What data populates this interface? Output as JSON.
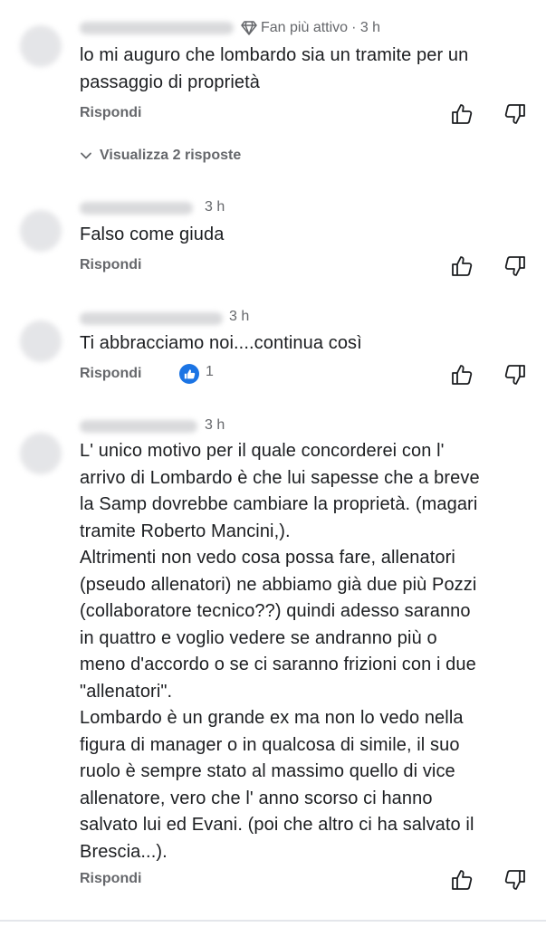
{
  "comments": [
    {
      "badge": "Fan più attivo",
      "time": "· 3 h",
      "lines": [
        "lo mi auguro che lombardo sia un tramite per un",
        "passaggio di proprietà"
      ],
      "reply_label": "Rispondi"
    },
    {
      "time": "3 h",
      "lines": [
        "Falso come giuda"
      ],
      "reply_label": "Rispondi"
    },
    {
      "time": "3 h",
      "lines": [
        "Ti abbracciamo noi....continua così"
      ],
      "reply_label": "Rispondi",
      "reactions": "1"
    },
    {
      "time": "3 h",
      "lines": [
        "L' unico motivo per il quale concorderei con l'",
        "arrivo di Lombardo è che lui sapesse che a breve",
        "la Samp dovrebbe cambiare la proprietà. (magari",
        "tramite Roberto Mancini,).",
        "Altrimenti non vedo cosa possa fare, allenatori",
        "(pseudo allenatori) ne abbiamo già  due più Pozzi",
        "(collaboratore tecnico??) quindi adesso saranno",
        "in quattro e voglio vedere se andranno più o",
        "meno d'accordo o se ci saranno frizioni con i due",
        "\"allenatori\".",
        "Lombardo è un grande ex ma non lo vedo nella",
        "figura di manager o in qualcosa di simile, il suo",
        "ruolo è sempre stato al massimo quello di vice",
        "allenatore, vero che l' anno scorso ci hanno",
        "salvato lui ed Evani.  (poi che altro ci ha salvato il",
        "Brescia...)."
      ],
      "reply_label": "Rispondi"
    }
  ],
  "view_replies": "Visualizza 2 risposte",
  "icons": {
    "like": "thumbs-up-icon",
    "dislike": "thumbs-down-icon",
    "badge": "diamond-icon",
    "chevron": "chevron-down-icon"
  },
  "colors": {
    "text": "#1c1e21",
    "muted": "#65676b",
    "like_blue": "#1b74e4"
  }
}
